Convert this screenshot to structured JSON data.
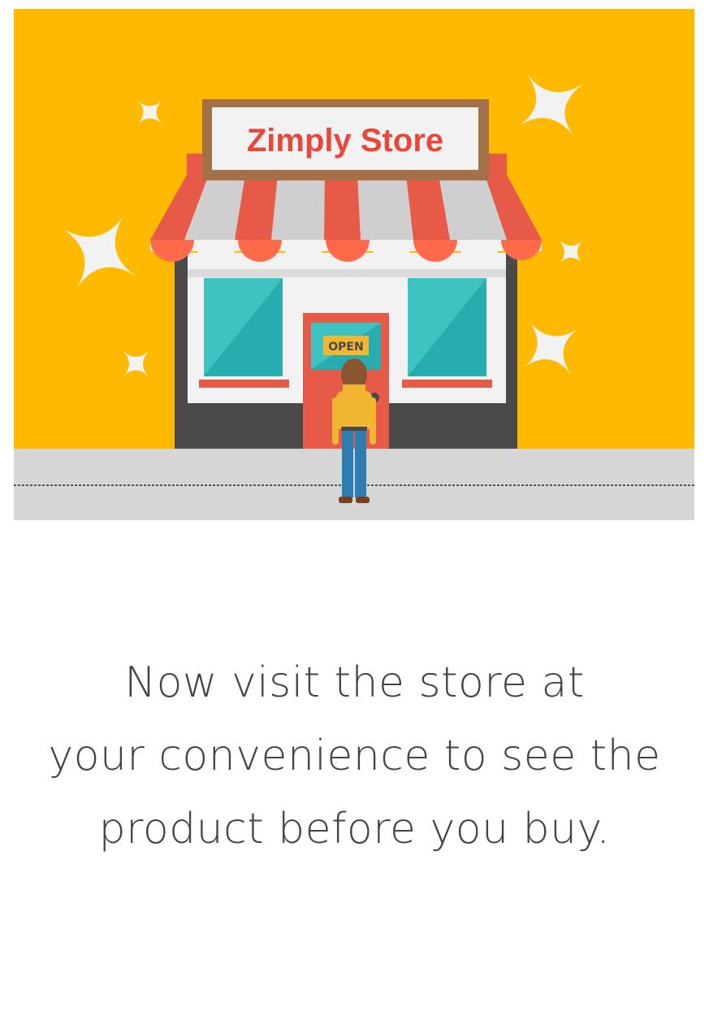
{
  "illustration": {
    "store_sign": "Zimply Store",
    "open_sign": "OPEN"
  },
  "caption": {
    "line1": "Now visit the store at",
    "line2": "your convenience to see the",
    "line3": "product before you buy."
  }
}
